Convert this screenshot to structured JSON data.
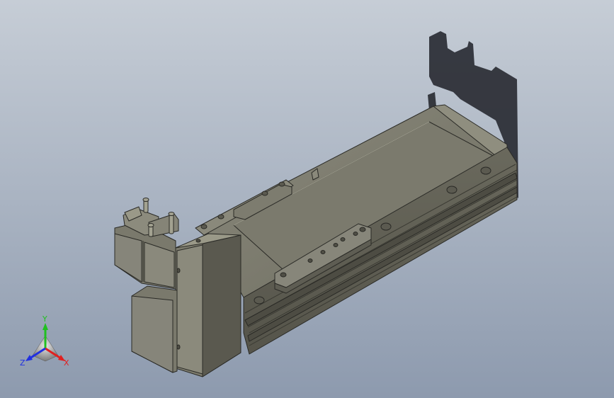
{
  "viewport": {
    "background_top": "#c6cdd6",
    "background_bottom": "#8d9aae"
  },
  "model": {
    "body_color": "#7e7d70",
    "body_dark": "#5f5e53",
    "body_light": "#9a9988",
    "edge_color": "#2a2a26",
    "shadow_color": "#2a2d34"
  },
  "triad": {
    "x_label": "X",
    "y_label": "Y",
    "z_label": "Z",
    "x_color": "#e02020",
    "y_color": "#20c020",
    "z_color": "#2030e0"
  }
}
